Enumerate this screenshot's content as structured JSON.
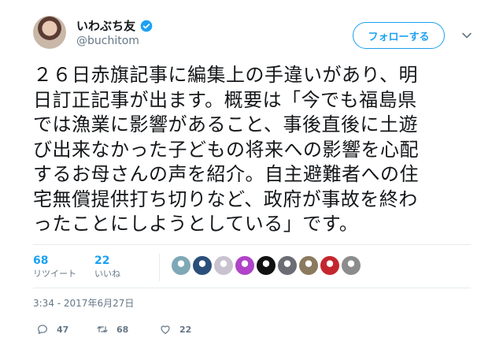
{
  "author": {
    "display_name": "いわぶち友",
    "handle": "@buchitom",
    "verified": true
  },
  "follow_button_label": "フォローする",
  "tweet_text": "２６日赤旗記事に編集上の手違いがあり、明\n日訂正記事が出ます。概要は「今でも福島県\nでは漁業に影響があること、事後直後に土遊\nび出来なかった子どもの将来への影響を心配\nするお母さんの声を紹介。自主避難者への住\n宅無償提供打ち切りなど、政府が事故を終わ\nったことにしようとしている」です。",
  "stats": {
    "retweets": {
      "count": "68",
      "label": "リツイート"
    },
    "likes": {
      "count": "22",
      "label": "いいね"
    }
  },
  "liker_avatars": [
    {
      "name": "liker-avatar-1",
      "color": "#7fa8b6"
    },
    {
      "name": "liker-avatar-2",
      "color": "#2a4f7a"
    },
    {
      "name": "liker-avatar-3",
      "color": "#c9c3cf"
    },
    {
      "name": "liker-avatar-4",
      "color": "#b043c9"
    },
    {
      "name": "liker-avatar-5",
      "color": "#111111"
    },
    {
      "name": "liker-avatar-6",
      "color": "#6b6c74"
    },
    {
      "name": "liker-avatar-7",
      "color": "#8a7a5e"
    },
    {
      "name": "liker-avatar-8",
      "color": "#c4262e"
    },
    {
      "name": "liker-avatar-9",
      "color": "#8c8c8c"
    }
  ],
  "timestamp": "3:34 - 2017年6月27日",
  "actions": {
    "reply_count": "47",
    "retweet_count": "68",
    "like_count": "22"
  },
  "colors": {
    "accent": "#1da1f2",
    "secondary_text": "#657786",
    "divider": "#e6ecf0"
  },
  "icons": [
    "verified-badge-icon",
    "chevron-down-icon",
    "reply-icon",
    "retweet-icon",
    "heart-icon"
  ]
}
